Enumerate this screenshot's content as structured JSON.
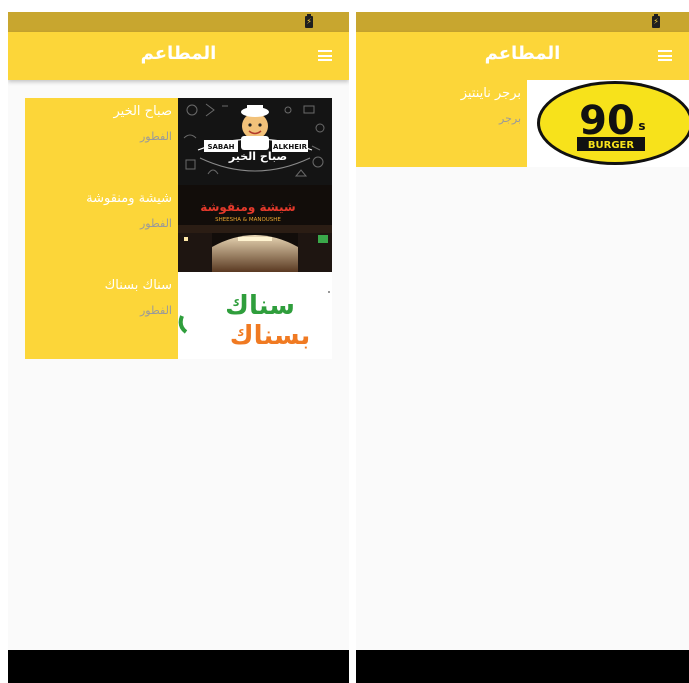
{
  "colors": {
    "status_bar": "#c8a62f",
    "app_bar": "#fcd639",
    "title_text": "#ffffff",
    "category_text": "#9a9a9a",
    "background": "#fafafa",
    "nav_bar": "#000000"
  },
  "left_screen": {
    "app_bar": {
      "title": "المطاعم",
      "menu_icon": "hamburger-menu-icon"
    },
    "restaurants": [
      {
        "name": "صباح الخير",
        "category": "الفطور",
        "logo_text_en_1": "SABAH",
        "logo_text_en_2": "ALKHEIR",
        "logo_text_ar": "صباح الخير"
      },
      {
        "name": "شيشة ومنقوشة",
        "category": "الفطور",
        "sign_text_ar": "شيشة ومنقوشة",
        "sign_text_en": "SHEESHA & MANOUSHE"
      },
      {
        "name": "سناك بسناك",
        "category": "الفطور",
        "logo_text_1": "سناك",
        "logo_text_2": "بسناك"
      }
    ]
  },
  "right_screen": {
    "app_bar": {
      "title": "المطاعم",
      "menu_icon": "hamburger-menu-icon"
    },
    "restaurants": [
      {
        "name": "برجر ناينتيز",
        "category": "برجر",
        "logo_number": "90",
        "logo_suffix": "s",
        "logo_word": "BURGER"
      }
    ]
  }
}
